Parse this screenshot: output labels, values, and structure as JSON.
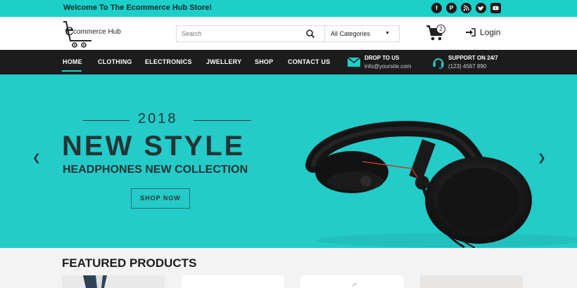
{
  "topbar": {
    "welcome": "Welcome To The Ecommerce Hub Store!",
    "socials": [
      "facebook-icon",
      "pinterest-icon",
      "rss-icon",
      "twitter-icon",
      "youtube-icon"
    ]
  },
  "header": {
    "logo_text": "commerce Hub",
    "logo_initial": "e",
    "search_placeholder": "Search",
    "category_selected": "All Categories",
    "cart_count": "2",
    "login_label": "Login"
  },
  "nav": {
    "items": [
      "HOME",
      "CLOTHING",
      "ELECTRONICS",
      "JWELLERY",
      "SHOP",
      "CONTACT US"
    ],
    "email_title": "DROP TO US",
    "email_value": "info@yoursite.com",
    "support_title": "SUPPORT ON 24/7",
    "support_value": "(123) 4567 890"
  },
  "hero": {
    "year": "2018",
    "title": "NEW STYLE",
    "subtitle": "HEADPHONES NEW COLLECTION",
    "button": "SHOP NOW",
    "prev_icon": "chevron-left-icon",
    "next_icon": "chevron-right-icon"
  },
  "featured": {
    "title": "FEATURED PRODUCTS"
  },
  "colors": {
    "accent": "#1ccfc9",
    "hero_bg": "#23cbc9",
    "nav_bg": "#1c1c1c",
    "dark_text": "#263434"
  }
}
